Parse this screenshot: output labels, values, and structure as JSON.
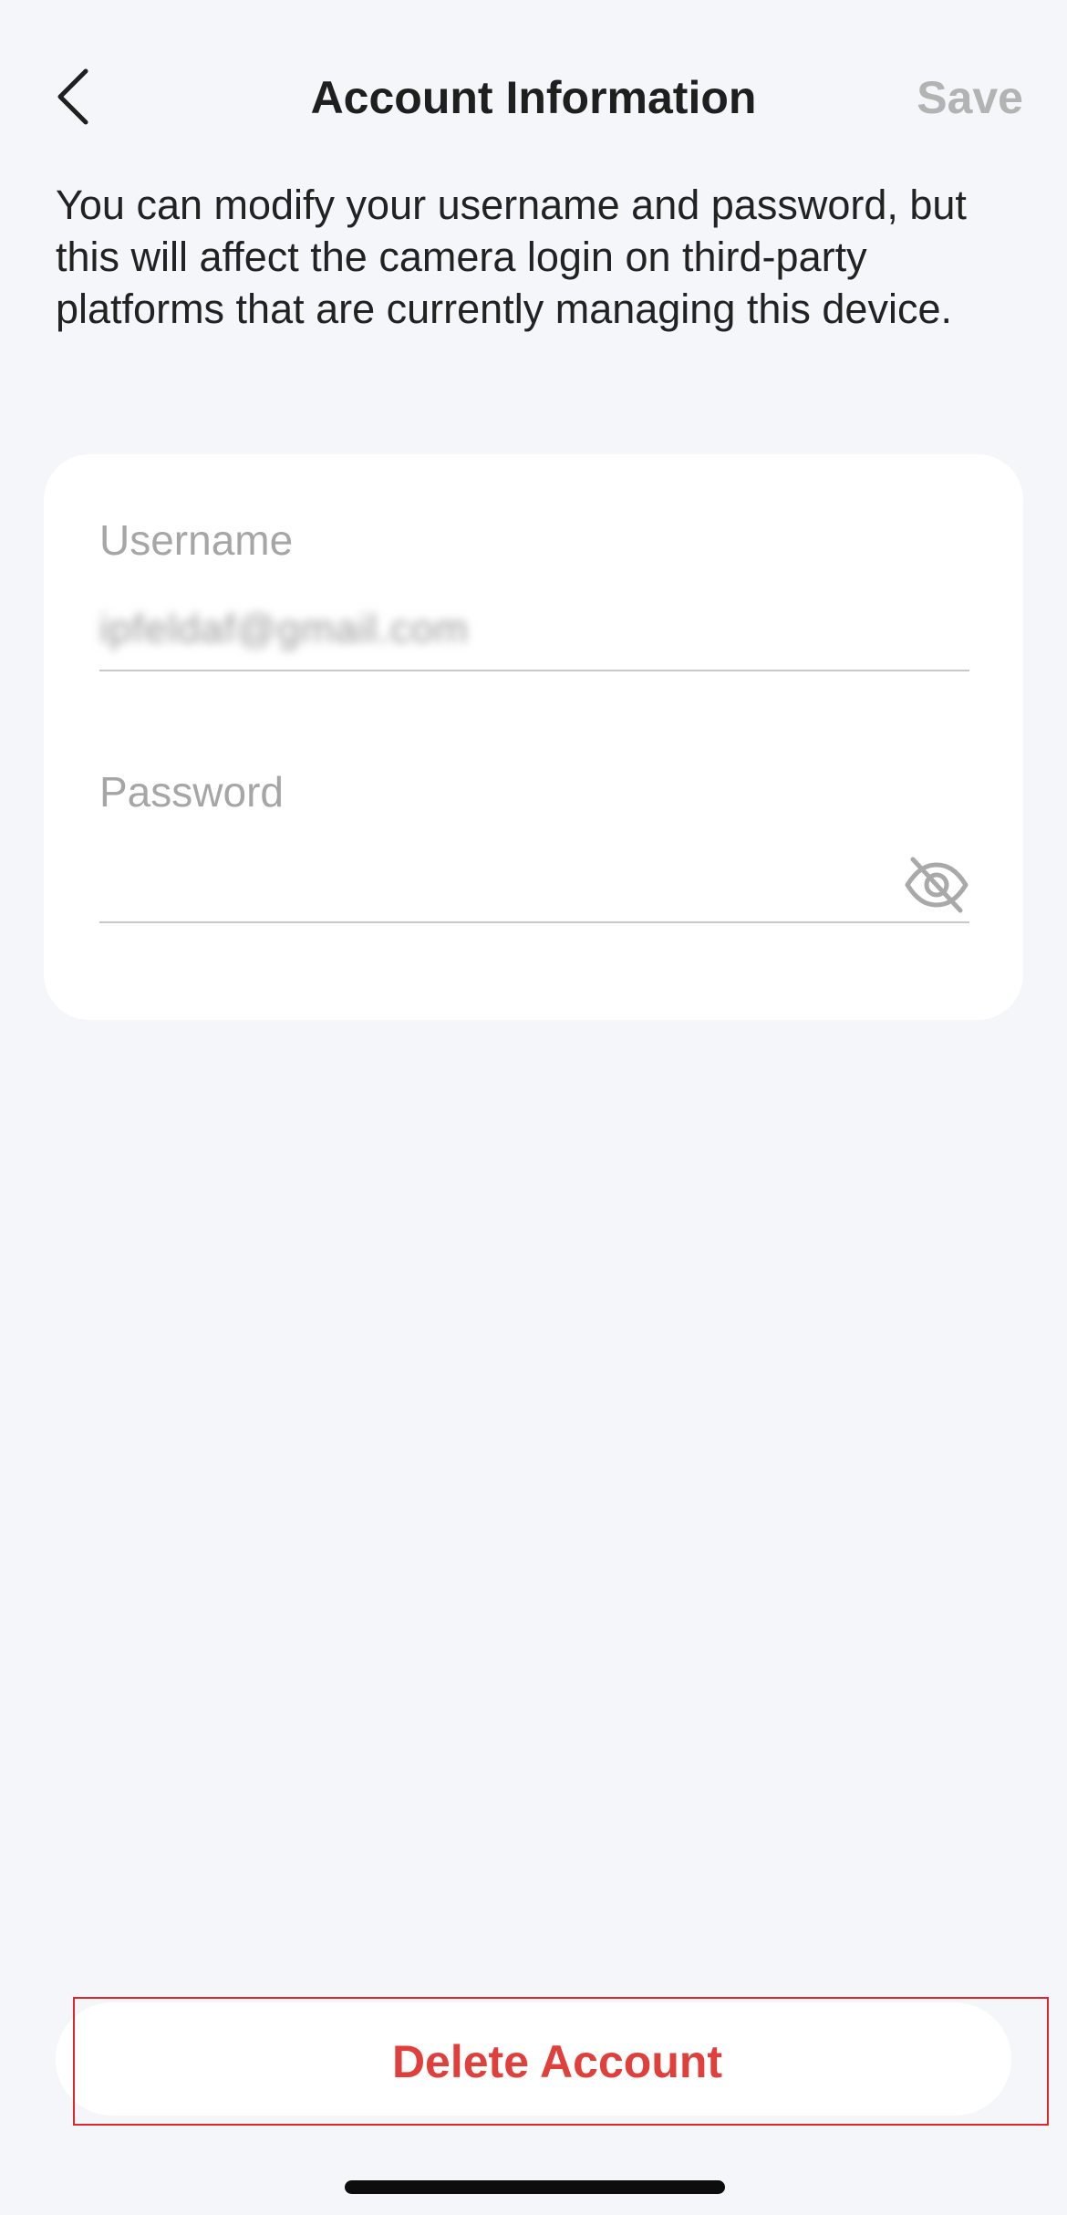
{
  "header": {
    "title": "Account Information",
    "save_label": "Save"
  },
  "description": "You can modify your username and password, but this will affect the camera login on third-party platforms that are currently managing this device.",
  "form": {
    "username": {
      "label": "Username",
      "value": "ipfeldaf@gmail.com"
    },
    "password": {
      "label": "Password",
      "value": "",
      "visibility_icon": "eye-off-icon"
    }
  },
  "actions": {
    "delete_label": "Delete Account"
  },
  "colors": {
    "background": "#f5f6fa",
    "card": "#ffffff",
    "danger": "#e0403c",
    "highlight_border": "#e0262b",
    "disabled_text": "#b3b3b3"
  }
}
